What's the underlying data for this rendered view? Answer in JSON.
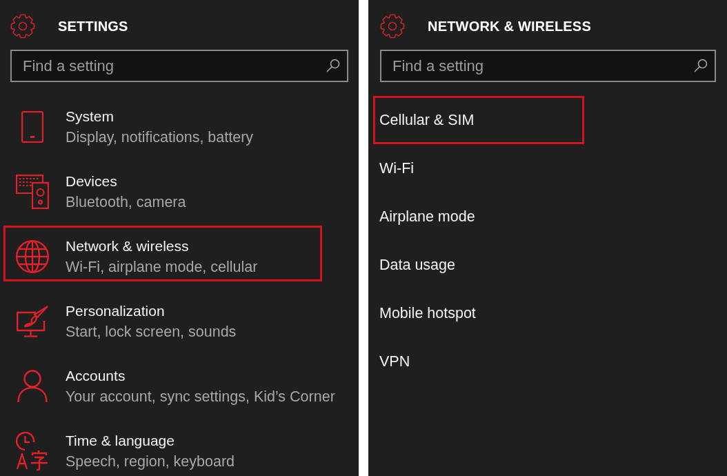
{
  "panels": [
    {
      "kind": "categories",
      "title": "SETTINGS",
      "search": {
        "placeholder": "Find a setting"
      },
      "items": [
        {
          "title": "System",
          "subtitle": "Display, notifications, battery",
          "highlighted": false
        },
        {
          "title": "Devices",
          "subtitle": "Bluetooth, camera",
          "highlighted": false
        },
        {
          "title": "Network & wireless",
          "subtitle": "Wi-Fi, airplane mode, cellular",
          "highlighted": true
        },
        {
          "title": "Personalization",
          "subtitle": "Start, lock screen, sounds",
          "highlighted": false
        },
        {
          "title": "Accounts",
          "subtitle": "Your account, sync settings, Kid’s Corner",
          "highlighted": false
        },
        {
          "title": "Time & language",
          "subtitle": "Speech, region, keyboard",
          "highlighted": false
        }
      ]
    },
    {
      "kind": "pages",
      "title": "NETWORK & WIRELESS",
      "search": {
        "placeholder": "Find a setting"
      },
      "items": [
        {
          "label": "Cellular & SIM",
          "highlighted": true
        },
        {
          "label": "Wi-Fi",
          "highlighted": false
        },
        {
          "label": "Airplane mode",
          "highlighted": false
        },
        {
          "label": "Data usage",
          "highlighted": false
        },
        {
          "label": "Mobile hotspot",
          "highlighted": false
        },
        {
          "label": "VPN",
          "highlighted": false
        }
      ]
    }
  ]
}
